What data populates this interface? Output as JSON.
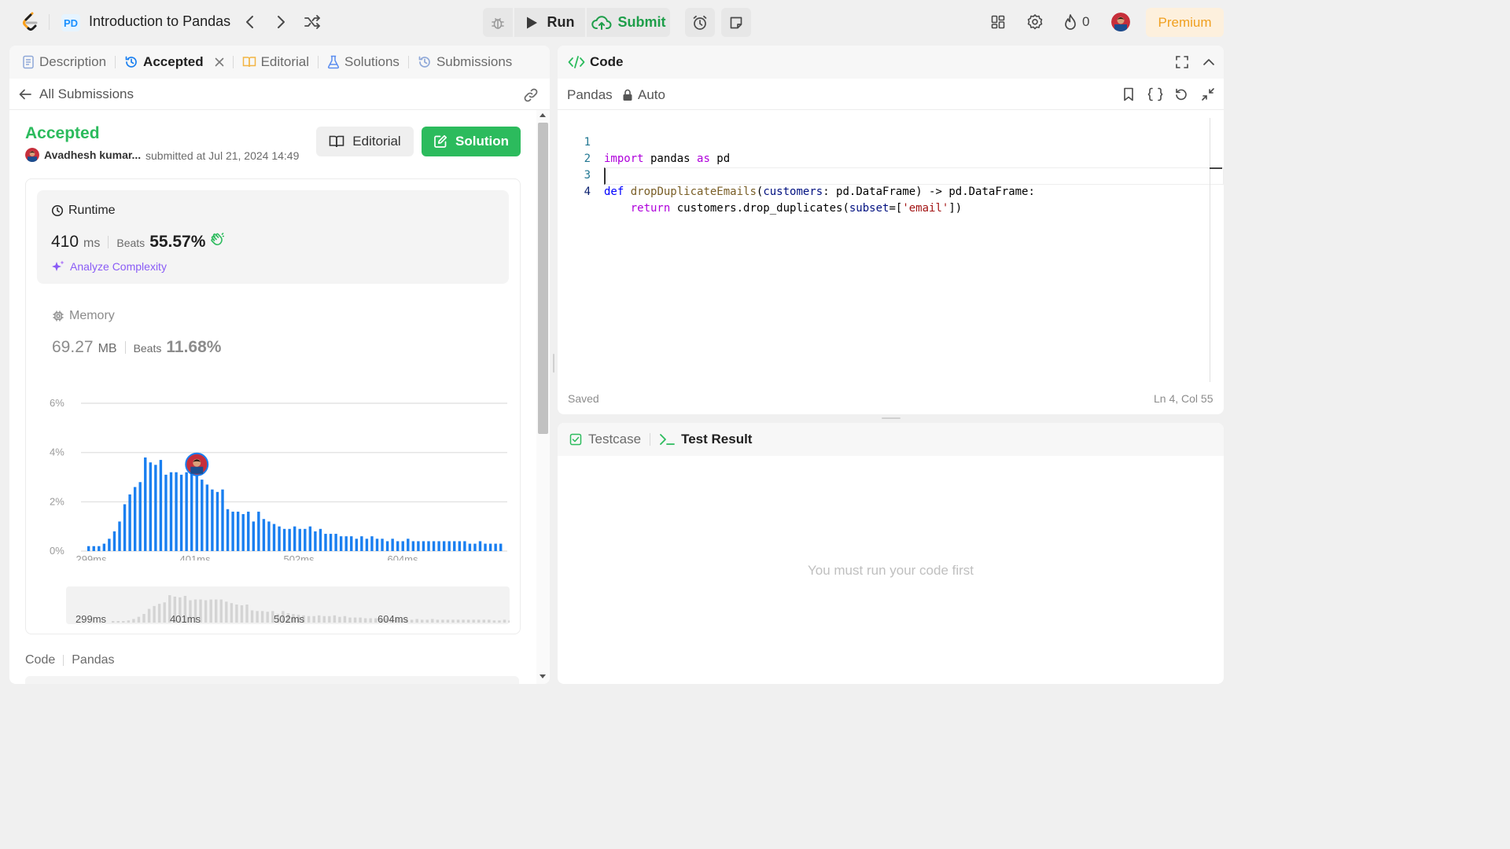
{
  "header": {
    "problem_badge": "PD",
    "problem_title": "Introduction to Pandas",
    "run_label": "Run",
    "submit_label": "Submit",
    "streak_count": "0",
    "premium_label": "Premium",
    "icons": [
      "logo-icon",
      "chevron-left-icon",
      "chevron-right-icon",
      "shuffle-icon",
      "bug-icon",
      "play-icon",
      "cloud-upload-icon",
      "alarm-icon",
      "note-icon",
      "layout-icon",
      "gear-icon",
      "fire-icon"
    ]
  },
  "left_tabs": [
    {
      "label": "Description",
      "icon": "description-icon"
    },
    {
      "label": "Accepted",
      "icon": "history-icon",
      "active": true
    },
    {
      "label": "Editorial",
      "icon": "book-icon"
    },
    {
      "label": "Solutions",
      "icon": "flask-icon"
    },
    {
      "label": "Submissions",
      "icon": "history-icon"
    }
  ],
  "submission": {
    "back_label": "All Submissions",
    "status": "Accepted",
    "user_name": "Avadhesh kumar...",
    "submitted_at": "submitted at Jul 21, 2024 14:49",
    "editorial_label": "Editorial",
    "solution_label": "Solution",
    "runtime_label": "Runtime",
    "runtime_value": "410",
    "runtime_unit": "ms",
    "beats_label": "Beats",
    "runtime_beats": "55.57%",
    "analyze_label": "Analyze Complexity",
    "memory_label": "Memory",
    "memory_value": "69.27",
    "memory_unit": "MB",
    "memory_beats": "11.68%",
    "code_label": "Code",
    "code_lang": "Pandas"
  },
  "colors": {
    "accepted_green": "#2cbb5d",
    "bar_blue": "#1a7ff0",
    "premium_orange": "#f0a020",
    "analyze_purple": "#8a5cf6"
  },
  "chart_data": {
    "type": "bar",
    "y_ticks": [
      "6%",
      "4%",
      "2%",
      "0%"
    ],
    "x_ticks": [
      "299ms",
      "401ms",
      "502ms",
      "604ms"
    ],
    "ylim": [
      0,
      6
    ],
    "values": [
      0.2,
      0.2,
      0.2,
      0.3,
      0.5,
      0.8,
      1.2,
      1.9,
      2.3,
      2.6,
      2.8,
      3.8,
      3.6,
      3.5,
      3.7,
      3.1,
      3.2,
      3.2,
      3.1,
      3.2,
      3.2,
      3.2,
      2.9,
      2.7,
      2.5,
      2.4,
      2.5,
      1.7,
      1.6,
      1.6,
      1.5,
      1.6,
      1.2,
      1.6,
      1.3,
      1.2,
      1.1,
      1.0,
      0.9,
      0.9,
      1.0,
      0.9,
      0.9,
      1.0,
      0.8,
      0.9,
      0.7,
      0.7,
      0.7,
      0.6,
      0.6,
      0.6,
      0.5,
      0.6,
      0.5,
      0.6,
      0.5,
      0.5,
      0.4,
      0.5,
      0.4,
      0.4,
      0.5,
      0.4,
      0.4,
      0.4,
      0.4,
      0.4,
      0.4,
      0.4,
      0.4,
      0.4,
      0.4,
      0.4,
      0.3,
      0.3,
      0.4,
      0.3,
      0.3,
      0.3,
      0.3
    ],
    "x_range_ms": [
      299,
      709
    ],
    "highlight_index": 21,
    "mini_x_ticks": [
      "299ms",
      "401ms",
      "502ms",
      "604ms"
    ]
  },
  "code_panel": {
    "title": "Code",
    "language": "Pandas",
    "mode": "Auto",
    "lines": [
      {
        "n": "1",
        "text": "import pandas as pd"
      },
      {
        "n": "2",
        "text": ""
      },
      {
        "n": "3",
        "text": "def dropDuplicateEmails(customers: pd.DataFrame) -> pd.DataFrame:"
      },
      {
        "n": "4",
        "text": "    return customers.drop_duplicates(subset=['email'])"
      }
    ],
    "saved_label": "Saved",
    "cursor_position": "Ln 4, Col 55"
  },
  "test_panel": {
    "tabs": [
      {
        "label": "Testcase",
        "icon": "checkbox-icon"
      },
      {
        "label": "Test Result",
        "icon": "terminal-icon",
        "active": true
      }
    ],
    "empty_message": "You must run your code first"
  }
}
